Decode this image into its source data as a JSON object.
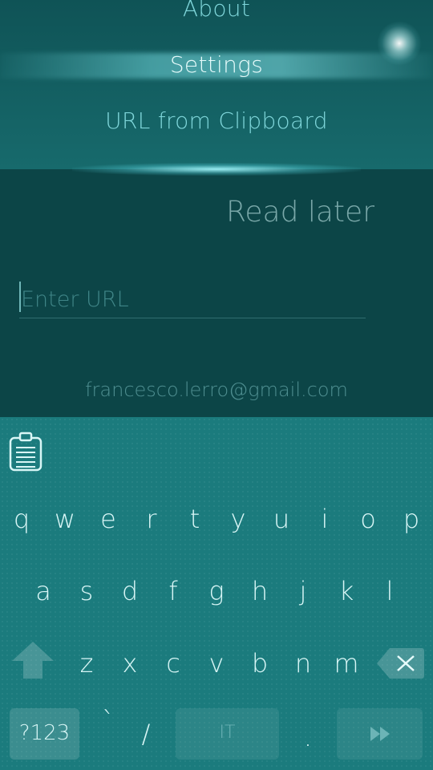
{
  "pulley_menu": {
    "items": [
      "About",
      "Settings",
      "URL from Clipboard"
    ]
  },
  "page": {
    "header": "Read later",
    "url_placeholder": "Enter URL",
    "footer_email": "francesco.lerro@gmail.com"
  },
  "keyboard": {
    "clipboard_icon": "clipboard-icon",
    "row1": [
      "q",
      "w",
      "e",
      "r",
      "t",
      "y",
      "u",
      "i",
      "o",
      "p"
    ],
    "row2": [
      "a",
      "s",
      "d",
      "f",
      "g",
      "h",
      "j",
      "k",
      "l"
    ],
    "row3": [
      "z",
      "x",
      "c",
      "v",
      "b",
      "n",
      "m"
    ],
    "symbols_label": "?123",
    "backtick": "`",
    "slash": "/",
    "space_label": "IT",
    "period": ".",
    "shift_icon": "shift-arrow-icon",
    "backspace_icon": "backspace-icon",
    "enter_icon": "enter-arrow-icon",
    "accent_color": "#1b7b7d"
  }
}
